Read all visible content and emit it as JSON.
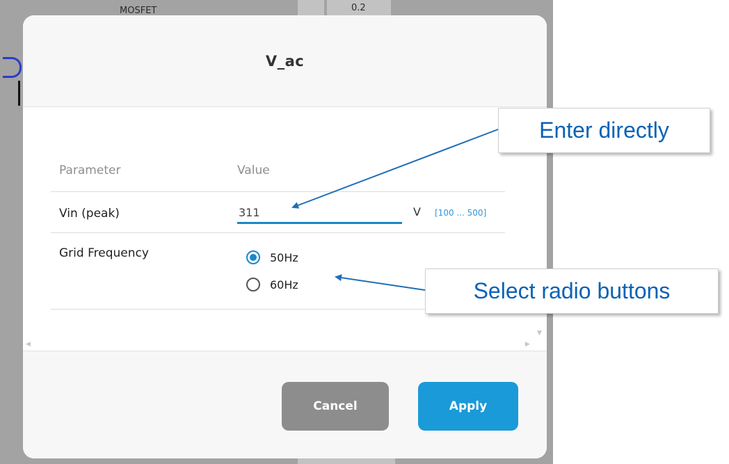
{
  "background": {
    "top_text": "MOSFET",
    "top_right_text": "0.2"
  },
  "dialog": {
    "title": "V_ac",
    "columns": {
      "parameter": "Parameter",
      "value": "Value"
    },
    "params": {
      "vin": {
        "label": "Vin (peak)",
        "value": "311",
        "unit": "V",
        "range": "[100 ... 500]"
      },
      "grid_frequency": {
        "label": "Grid Frequency",
        "options": [
          {
            "label": "50Hz",
            "selected": true
          },
          {
            "label": "60Hz",
            "selected": false
          }
        ]
      }
    },
    "buttons": {
      "cancel": "Cancel",
      "apply": "Apply"
    }
  },
  "annotations": {
    "enter_directly": "Enter directly",
    "select_radio": "Select radio buttons"
  },
  "colors": {
    "accent": "#1a88c9",
    "apply_button": "#1a9ad8",
    "cancel_button": "#8d8d8d",
    "callout_text": "#0a62b5",
    "arrow": "#1f6fb8"
  },
  "icons": [
    "radio-checked-icon",
    "radio-unchecked-icon",
    "scroll-left-arrow-icon",
    "scroll-right-arrow-icon",
    "scroll-down-arrow-icon"
  ]
}
